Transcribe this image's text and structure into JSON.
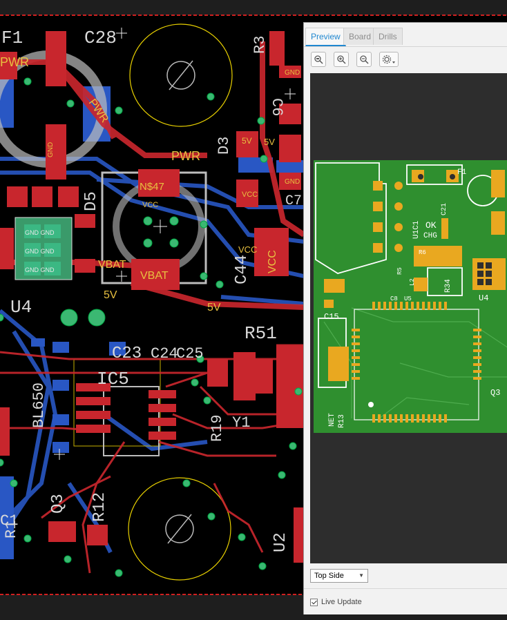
{
  "board": {
    "power_labels": [
      "PWR",
      "PWR",
      "PWR"
    ],
    "net_labels": [
      "5V",
      "5V",
      "5V",
      "5V",
      "5V",
      "VCC",
      "VCC",
      "VCC",
      "VCC",
      "VBAT",
      "VBAT",
      "VBAT",
      "GND",
      "GND",
      "GND",
      "N$47"
    ],
    "designators": [
      "C28",
      "R3",
      "C6",
      "D3",
      "C7",
      "D5",
      "C44",
      "U4",
      "C23",
      "C24",
      "C25",
      "R51",
      "IC5",
      "R19",
      "Y1",
      "R12",
      "Q3",
      "U2",
      "R1",
      "BL650",
      "C1",
      "F1",
      "GND GND",
      "GND GND",
      "GND GND"
    ]
  },
  "panel": {
    "tabs": [
      "Preview",
      "Board",
      "Drills"
    ],
    "tools": [
      "zoom-fit-icon",
      "zoom-in-icon",
      "zoom-out-icon",
      "settings-icon"
    ],
    "side_select": "Top Side",
    "live_update_label": "Live Update",
    "live_update_checked": true,
    "preview_labels": [
      "F1",
      "C21",
      "OK",
      "CHG",
      "U1C1",
      "R6",
      "R5",
      "L2",
      "C8",
      "U5",
      "R34",
      "U4",
      "C15",
      "Q3",
      "NET",
      "R13"
    ]
  },
  "colors": {
    "copper_top": "#c8262d",
    "copper_bottom": "#2957c4",
    "silkscreen": "#d9d9d9",
    "pad_label": "#e8c040",
    "pcb_green": "#2f8f2f",
    "pcb_pad": "#e9a820",
    "accent_tab": "#1f87d0"
  }
}
